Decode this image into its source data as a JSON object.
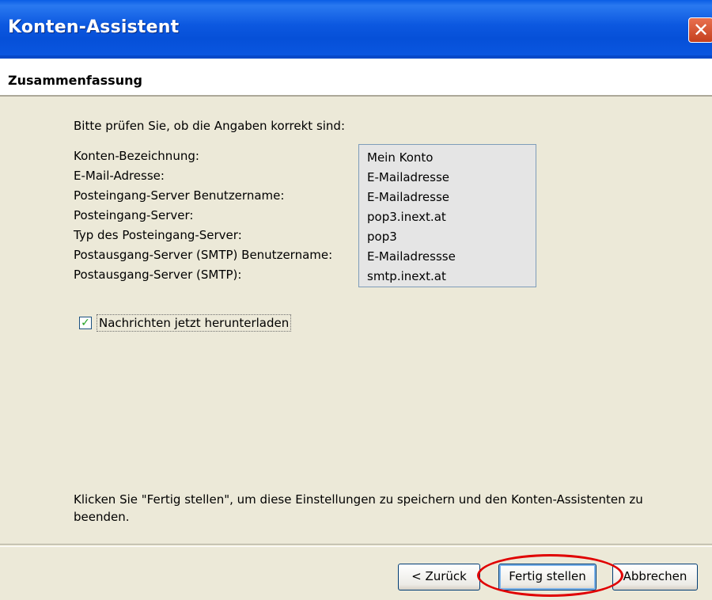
{
  "window": {
    "title": "Konten-Assistent",
    "close_glyph": "✕"
  },
  "header": {
    "title": "Zusammenfassung"
  },
  "content": {
    "intro": "Bitte prüfen Sie, ob die Angaben korrekt sind:",
    "fields": [
      {
        "label": "Konten-Bezeichnung:",
        "value": "Mein Konto"
      },
      {
        "label": "E-Mail-Adresse:",
        "value": "E-Mailadresse"
      },
      {
        "label": "Posteingang-Server Benutzername:",
        "value": "E-Mailadresse"
      },
      {
        "label": "Posteingang-Server:",
        "value": "pop3.inext.at"
      },
      {
        "label": "Typ des Posteingang-Server:",
        "value": "pop3"
      },
      {
        "label": "Postausgang-Server (SMTP) Benutzername:",
        "value": "E-Mailadressse"
      },
      {
        "label": "Postausgang-Server (SMTP):",
        "value": "smtp.inext.at"
      }
    ],
    "download_checkbox": {
      "label": "Nachrichten jetzt herunterladen",
      "checked": true,
      "check_glyph": "✓"
    },
    "finish_text": "Klicken Sie \"Fertig stellen\", um diese Einstellungen zu speichern und den Konten-Assistenten zu beenden."
  },
  "buttons": {
    "back": "< Zurück",
    "finish": "Fertig stellen",
    "cancel": "Abbrechen"
  },
  "colors": {
    "titlebar": "#0a56e0",
    "dialog_bg": "#ece9d8",
    "highlight": "#e00000"
  }
}
